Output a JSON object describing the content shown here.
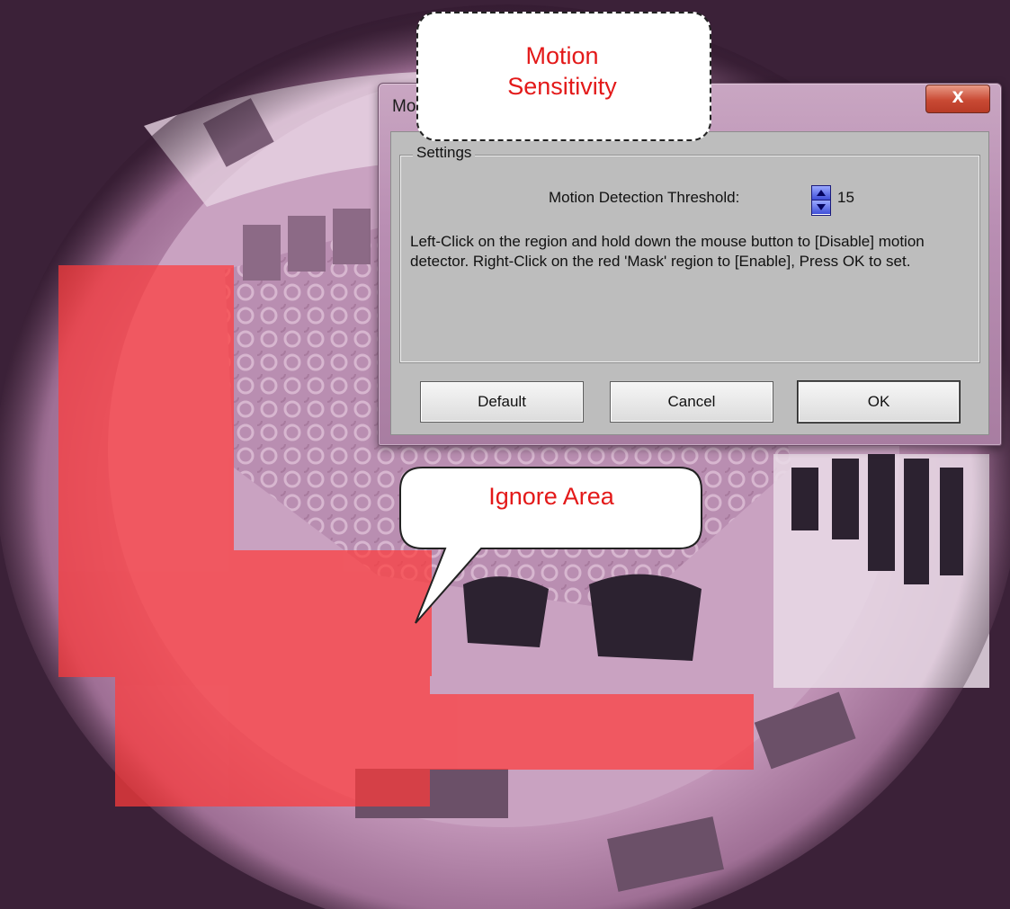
{
  "dialog": {
    "title": "Mo...ng",
    "close_glyph": "X",
    "group_label": "Settings",
    "threshold_label": "Motion Detection Threshold:",
    "threshold_value": "15",
    "help_text": "Left-Click on the region and hold down the mouse button to [Disable] motion detector. Right-Click on the red 'Mask' region to [Enable], Press OK to set.",
    "buttons": {
      "default": "Default",
      "cancel": "Cancel",
      "ok": "OK"
    }
  },
  "callouts": {
    "sensitivity_line1": "Motion",
    "sensitivity_line2": "Sensitivity",
    "ignore": "Ignore Area"
  },
  "colors": {
    "mask_red": "#ff3b3b",
    "callout_text": "#e31919",
    "camera_tint": "#c99bbf"
  }
}
